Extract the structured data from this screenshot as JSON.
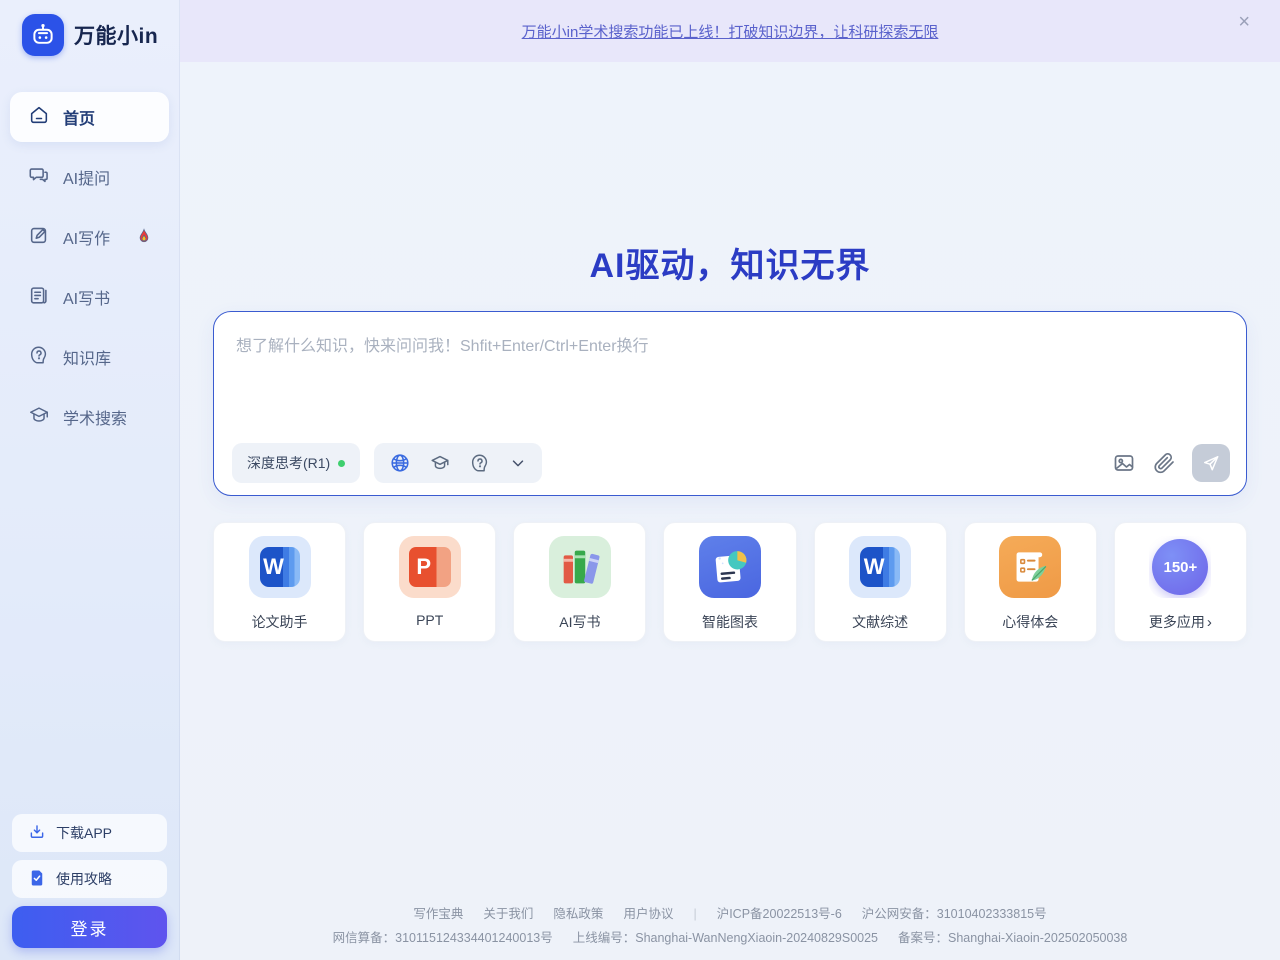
{
  "colors": {
    "accent": "#2b52e8",
    "heading": "#2b3cc4",
    "banner_bg": "#e8e7fa",
    "banner_link": "#5a62cc",
    "login_gradient_start": "#3d5ef0",
    "login_gradient_end": "#5f54ee",
    "online_dot": "#3ecf6e",
    "send_disabled": "#c5ccd8"
  },
  "icons": {
    "close": "×",
    "chevron_right": "›",
    "logo": "robot-icon",
    "nav": [
      "home-icon",
      "chat-icon",
      "edit-icon",
      "book-icon",
      "knowledge-icon",
      "academic-cap-icon"
    ],
    "composer": [
      "globe-icon",
      "academic-cap-icon",
      "think-head-icon",
      "chevron-down-icon",
      "image-icon",
      "paperclip-icon",
      "send-plane-icon"
    ]
  },
  "brand": {
    "name": "万能小in"
  },
  "banner": {
    "text": "万能小in学术搜索功能已上线！打破知识边界，让科研探索无限"
  },
  "sidebar": {
    "items": [
      {
        "label": "首页",
        "active": true
      },
      {
        "label": "AI提问",
        "active": false
      },
      {
        "label": "AI写作",
        "active": false,
        "hot": true
      },
      {
        "label": "AI写书",
        "active": false
      },
      {
        "label": "知识库",
        "active": false
      },
      {
        "label": "学术搜索",
        "active": false
      }
    ],
    "bottom": [
      {
        "label": "下载APP"
      },
      {
        "label": "使用攻略"
      }
    ],
    "login_label": "登录"
  },
  "hero": {
    "title": "AI驱动，知识无界"
  },
  "composer": {
    "placeholder": "想了解什么知识，快来问问我！Shfit+Enter/Ctrl+Enter换行",
    "mode_label": "深度思考(R1)"
  },
  "apps": [
    {
      "label": "论文助手",
      "glyph": "W"
    },
    {
      "label": "PPT",
      "glyph": "P"
    },
    {
      "label": "AI写书"
    },
    {
      "label": "智能图表"
    },
    {
      "label": "文献综述",
      "glyph": "W"
    },
    {
      "label": "心得体会"
    },
    {
      "label": "更多应用",
      "badge": "150+"
    }
  ],
  "footer": {
    "links": [
      "写作宝典",
      "关于我们",
      "隐私政策",
      "用户协议"
    ],
    "separator": "|",
    "icp": "沪ICP备20022513号-6",
    "police": "沪公网安备：31010402333815号",
    "line2": {
      "netinfo": "网信算备：310115124334401240013号",
      "online_no": "上线编号：Shanghai-WanNengXiaoin-20240829S0025",
      "record_no": "备案号：Shanghai-Xiaoin-202502050038"
    }
  }
}
